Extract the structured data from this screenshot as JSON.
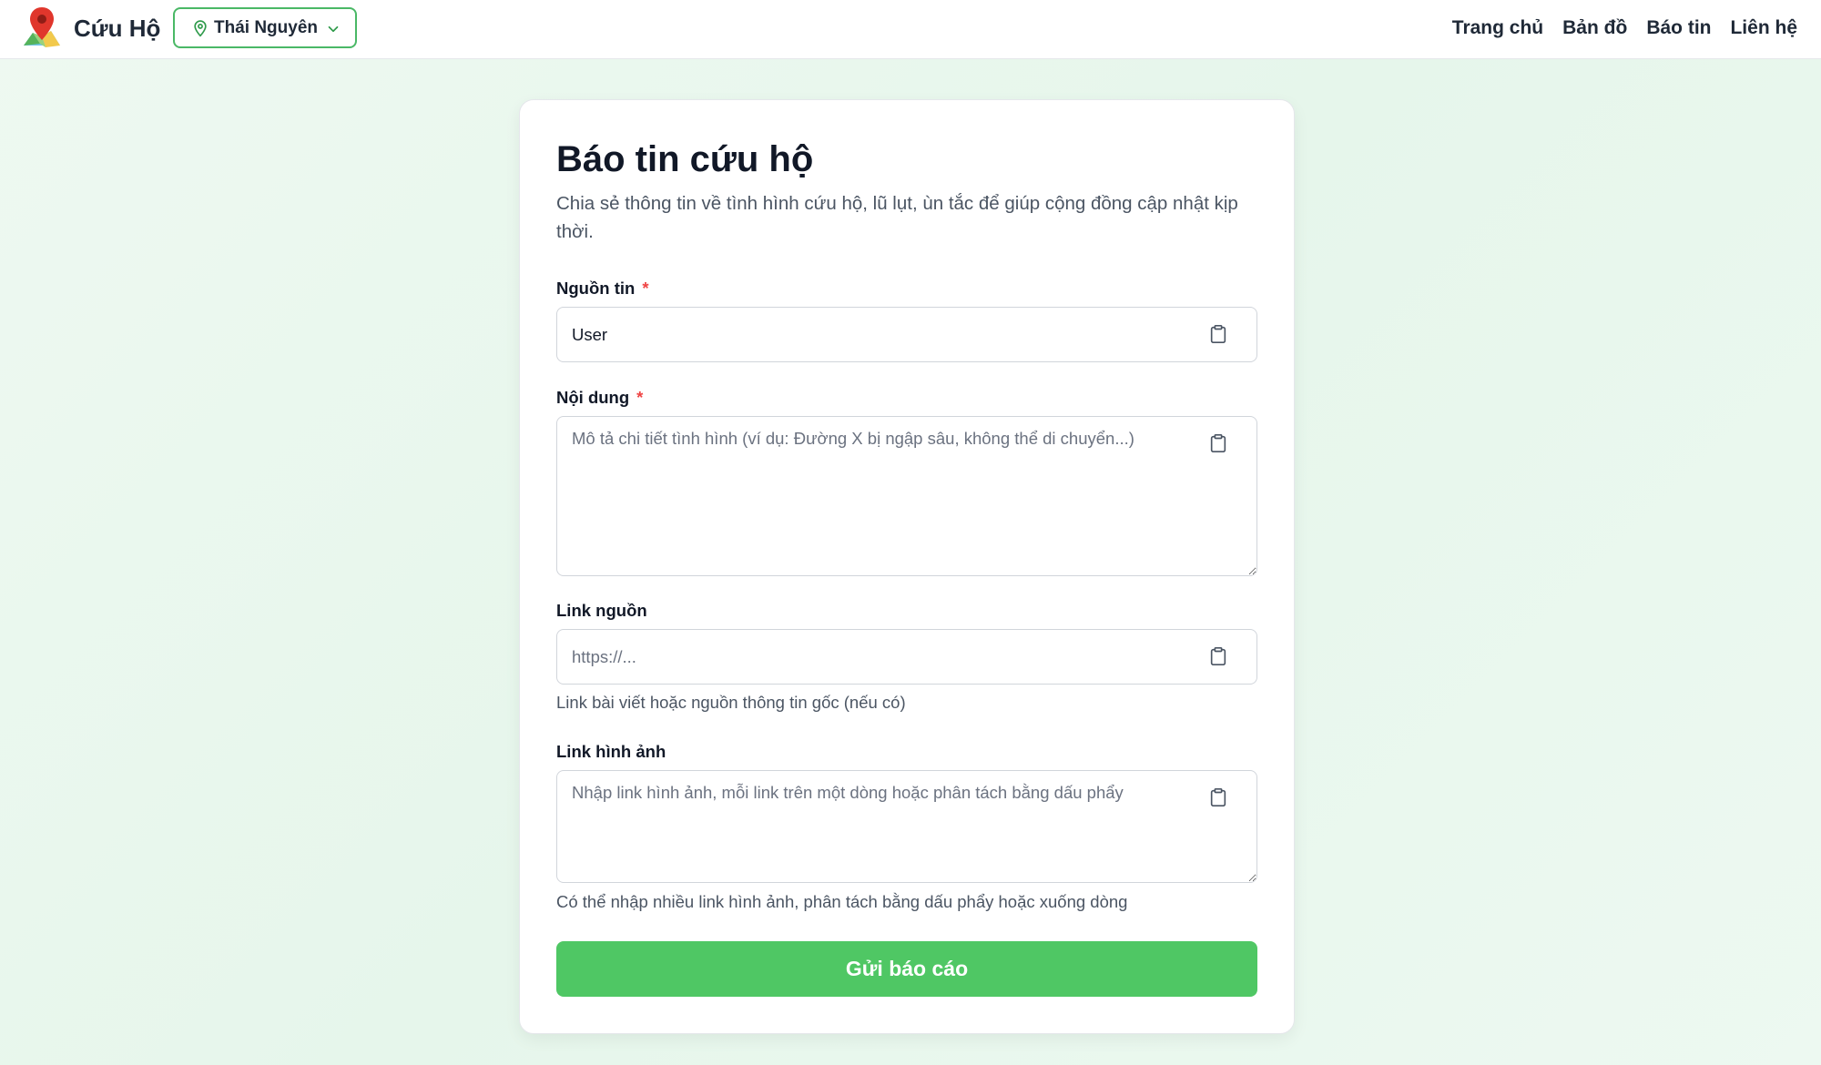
{
  "header": {
    "brand": "Cứu Hộ",
    "location": "Thái Nguyên",
    "nav": [
      "Trang chủ",
      "Bản đồ",
      "Báo tin",
      "Liên hệ"
    ]
  },
  "form": {
    "title": "Báo tin cứu hộ",
    "subtitle": "Chia sẻ thông tin về tình hình cứu hộ, lũ lụt, ùn tắc để giúp cộng đồng cập nhật kịp thời.",
    "source": {
      "label": "Nguồn tin",
      "required_mark": "*",
      "value": "User"
    },
    "content": {
      "label": "Nội dung",
      "required_mark": "*",
      "placeholder": "Mô tả chi tiết tình hình (ví dụ: Đường X bị ngập sâu, không thể di chuyển...)"
    },
    "source_link": {
      "label": "Link nguồn",
      "placeholder": "https://...",
      "hint": "Link bài viết hoặc nguồn thông tin gốc (nếu có)"
    },
    "image_links": {
      "label": "Link hình ảnh",
      "placeholder": "Nhập link hình ảnh, mỗi link trên một dòng hoặc phân tách bằng dấu phẩy",
      "hint": "Có thể nhập nhiều link hình ảnh, phân tách bằng dấu phẩy hoặc xuống dòng"
    },
    "submit_label": "Gửi báo cáo"
  },
  "icons": {
    "logo": "map-pin-logo-icon",
    "location": "map-pin-icon",
    "dropdown": "chevron-down-icon",
    "paste": "clipboard-icon"
  },
  "colors": {
    "accent": "#4fc764",
    "location_border": "#4ab866",
    "required": "#ef4444",
    "pin_red": "#e0362c"
  }
}
